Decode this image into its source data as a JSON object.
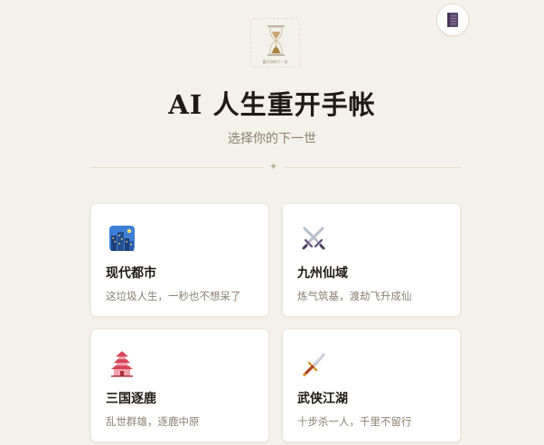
{
  "header": {
    "logo_caption": "重开你的下一世",
    "title": "AI 人生重开手帐",
    "subtitle": "选择你的下一世",
    "divider_glyph": "✦",
    "corner_button_icon": "notebook-icon"
  },
  "worlds": [
    {
      "icon": "city-icon",
      "name": "现代都市",
      "desc": "这垃圾人生，一秒也不想呆了"
    },
    {
      "icon": "crossed-swords-icon",
      "name": "九州仙域",
      "desc": "炼气筑基，渡劫飞升成仙"
    },
    {
      "icon": "pagoda-icon",
      "name": "三国逐鹿",
      "desc": "乱世群雄，逐鹿中原"
    },
    {
      "icon": "dagger-icon",
      "name": "武侠江湖",
      "desc": "十步杀一人，千里不留行"
    }
  ],
  "colors": {
    "background": "#f4f1ea",
    "card": "#ffffff",
    "title": "#1f1a14",
    "muted": "#8a7f70"
  }
}
